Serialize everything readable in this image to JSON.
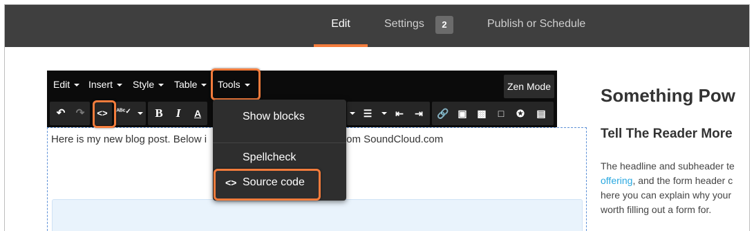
{
  "nav": {
    "tabs": [
      {
        "label": "Edit"
      },
      {
        "label": "Settings"
      },
      {
        "label": "Publish or Schedule"
      }
    ],
    "settings_badge": "2"
  },
  "editor": {
    "menu": [
      "Edit",
      "Insert",
      "Style",
      "Table",
      "Tools"
    ],
    "zen_mode": "Zen Mode",
    "content_text_left": "Here is my new blog post. Below i",
    "content_text_right": "om SoundCloud.com"
  },
  "tools_menu": {
    "items": [
      {
        "label": "Show blocks"
      },
      {
        "label": "Spellcheck"
      },
      {
        "label": "Source code",
        "icon": "<>"
      }
    ]
  },
  "preview": {
    "title": "Something Pow",
    "subtitle": "Tell The Reader More",
    "body_line1": "The headline and subheader te",
    "body_link": "offering",
    "body_line2_rest": ", and the form header c",
    "body_line3": "here you can explain why your",
    "body_line4": "worth filling out a form for."
  },
  "colors": {
    "accent": "#f47c3c",
    "nav_bg": "#3f3f3f",
    "toolbar_bg": "#0b0b0b",
    "link": "#29a8e0"
  }
}
